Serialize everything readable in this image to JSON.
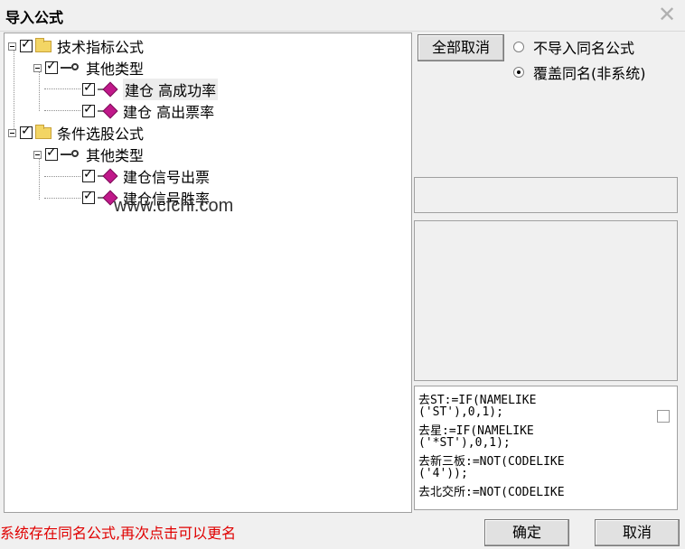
{
  "window": {
    "title": "导入公式",
    "close": "✕"
  },
  "tree": {
    "n1": "技术指标公式",
    "n1a": "其他类型",
    "n1a1": "建仓 高成功率",
    "n1a2": "建仓 高出票率",
    "n2": "条件选股公式",
    "n2a": "其他类型",
    "n2a1": "建仓信号出票",
    "n2a2": "建仓信号胜率"
  },
  "watermark": "www.cfchi.com",
  "buttons": {
    "cancel_all": "全部取消",
    "ok": "确定",
    "cancel": "取消"
  },
  "options": {
    "no_import": "不导入同名公式",
    "overwrite": "覆盖同名(非系统)",
    "selected": "overwrite"
  },
  "code": [
    "去ST:=IF(NAMELIKE",
    "('ST'),0,1);",
    "去星:=IF(NAMELIKE",
    "('*ST'),0,1);",
    "去新三板:=NOT(CODELIKE",
    "('4'));",
    "去北交所:=NOT(CODELIKE"
  ],
  "status": "系统存在同名公式,再次点击可以更名"
}
